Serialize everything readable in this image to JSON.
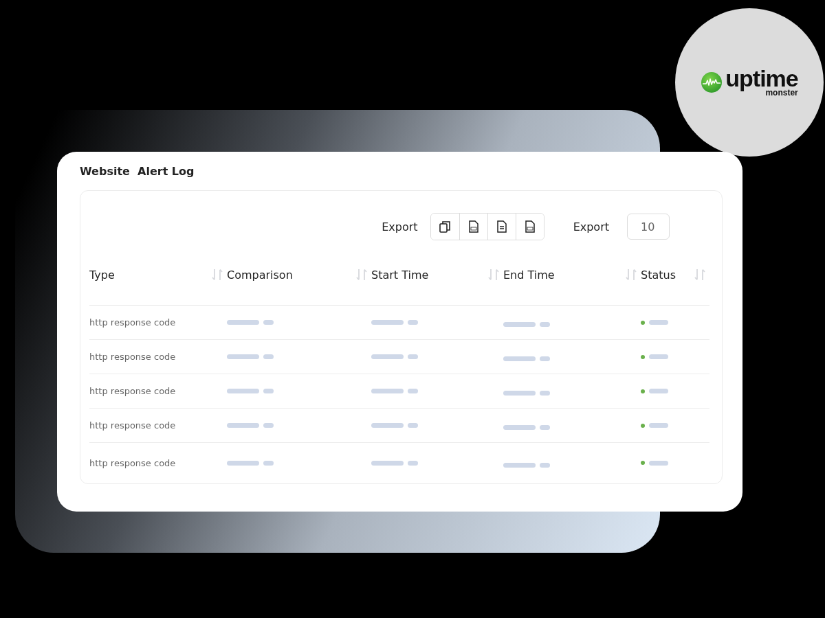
{
  "logo": {
    "name": "uptime",
    "tagline": "monster"
  },
  "card": {
    "title": "Website  Alert Log"
  },
  "toolbar": {
    "export_label": "Export",
    "page_size_label": "Export",
    "page_size_value": "10"
  },
  "table": {
    "columns": [
      {
        "label": "Type"
      },
      {
        "label": "Comparison"
      },
      {
        "label": "Start Time"
      },
      {
        "label": "End Time"
      },
      {
        "label": "Status"
      }
    ],
    "rows": [
      {
        "type": "http response code",
        "color": "#6ab04c"
      },
      {
        "type": "http response code",
        "color": "#6ab04c"
      },
      {
        "type": "http response code",
        "color": "#6ab04c"
      },
      {
        "type": "http response code",
        "color": "#6ab04c"
      },
      {
        "type": "http response code",
        "color": "#6ab04c"
      }
    ]
  }
}
